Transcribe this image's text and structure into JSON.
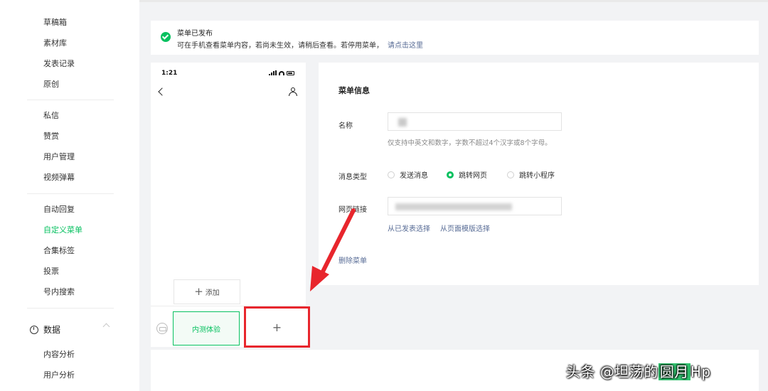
{
  "sidebar": {
    "items": [
      {
        "label": "草稿箱",
        "active": false
      },
      {
        "label": "素材库",
        "active": false
      },
      {
        "label": "发表记录",
        "active": false
      },
      {
        "label": "原创",
        "active": false
      },
      {
        "label": "私信",
        "active": false
      },
      {
        "label": "赞赏",
        "active": false
      },
      {
        "label": "用户管理",
        "active": false
      },
      {
        "label": "视频弹幕",
        "active": false
      },
      {
        "label": "自动回复",
        "active": false
      },
      {
        "label": "自定义菜单",
        "active": true
      },
      {
        "label": "合集标签",
        "active": false
      },
      {
        "label": "投票",
        "active": false
      },
      {
        "label": "号内搜索",
        "active": false
      }
    ],
    "section": "数据",
    "section_items": [
      "内容分析",
      "用户分析"
    ]
  },
  "notice": {
    "title": "菜单已发布",
    "message": "可在手机查看菜单内容，若尚未生效，请稍后查看。若停用菜单，",
    "link": "请点击这里"
  },
  "phone": {
    "time": "1:21",
    "add_submenu": "添加",
    "menu_item": "内测体验",
    "add_menu": "+"
  },
  "editor": {
    "title": "菜单信息",
    "name_label": "名称",
    "name_hint": "仅支持中英文和数字，字数不超过4个汉字或8个字母。",
    "msg_type_label": "消息类型",
    "options": [
      {
        "label": "发送消息",
        "selected": false
      },
      {
        "label": "跳转网页",
        "selected": true
      },
      {
        "label": "跳转小程序",
        "selected": false
      }
    ],
    "url_label": "网页链接",
    "link_published": "从已发表选择",
    "link_template": "从页面模版选择",
    "delete": "删除菜单"
  },
  "watermark": {
    "prefix": "头条 @坦荡的",
    "highlight": "圆月",
    "suffix": "Hp"
  },
  "colors": {
    "accent": "#07c160",
    "link": "#576b95",
    "highlight_box": "#e8262d"
  }
}
